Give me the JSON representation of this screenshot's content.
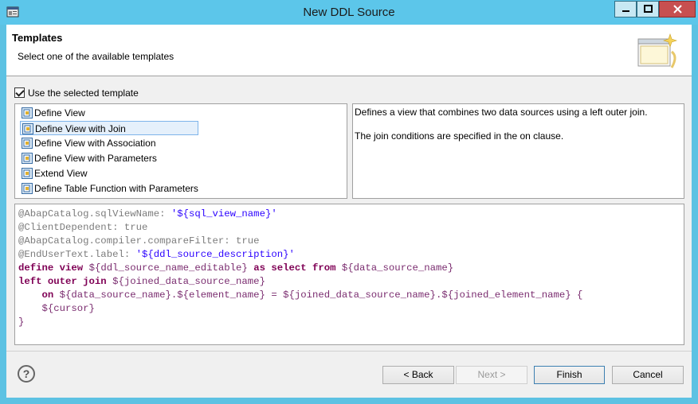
{
  "window": {
    "title": "New DDL Source"
  },
  "header": {
    "title": "Templates",
    "subtitle": "Select one of the available templates"
  },
  "use_template": {
    "label": "Use the selected template",
    "checked": true
  },
  "templates": [
    {
      "label": "Define View"
    },
    {
      "label": "Define View with Join",
      "selected": true
    },
    {
      "label": "Define View with Association"
    },
    {
      "label": "Define View with Parameters"
    },
    {
      "label": "Extend View"
    },
    {
      "label": "Define Table Function with Parameters"
    }
  ],
  "description": {
    "line1": "Defines a view that combines two data sources using a left outer join.",
    "line2": "The join conditions are specified in the on clause."
  },
  "code_lines": {
    "l1a": "@AbapCatalog.sqlViewName: ",
    "l1b": "'${sql_view_name}'",
    "l2": "@ClientDependent: true",
    "l3": "@AbapCatalog.compiler.compareFilter: true",
    "l4a": "@EndUserText.label: ",
    "l4b": "'${ddl_source_description}'",
    "l5a": "define view",
    "l5b": " ${ddl_source_name_editable} ",
    "l5c": "as select from",
    "l5d": " ${data_source_name}",
    "l6a": "left outer join",
    "l6b": " ${joined_data_source_name}",
    "l7a": "    on",
    "l7b": " ${data_source_name}.${element_name} = ${joined_data_source_name}.${joined_element_name} {",
    "l8": "    ${cursor}",
    "l9": "}"
  },
  "buttons": {
    "back": "< Back",
    "next": "Next >",
    "finish": "Finish",
    "cancel": "Cancel"
  },
  "help": {
    "glyph": "?"
  }
}
